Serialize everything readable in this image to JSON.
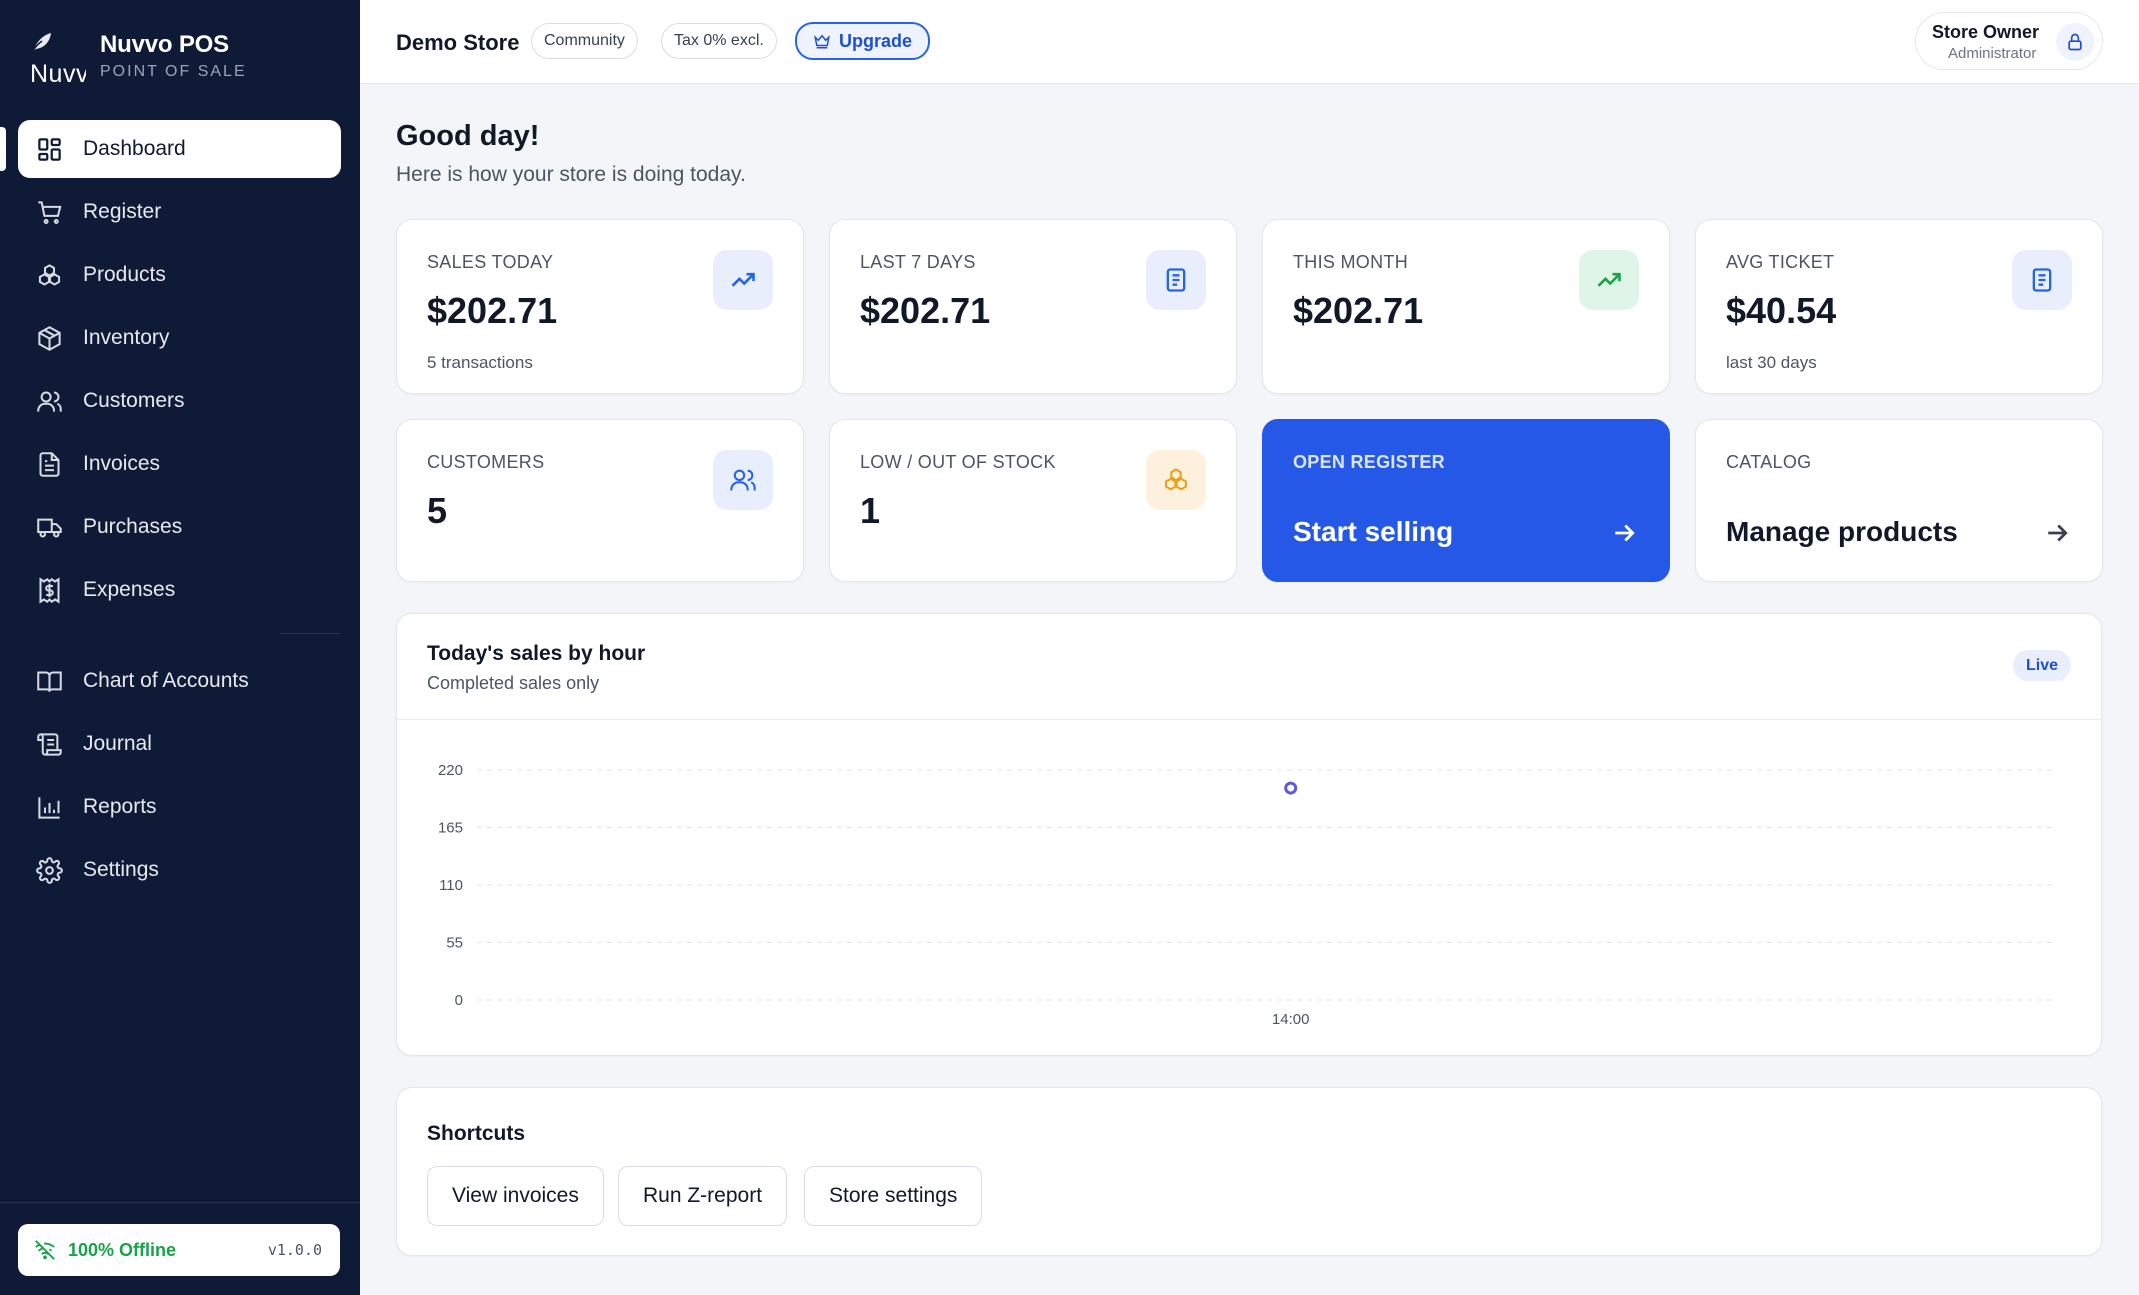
{
  "brand": {
    "logo_text": "Nuvvo",
    "name": "Nuvvo POS",
    "subtitle": "POINT OF SALE"
  },
  "sidebar": {
    "items": [
      {
        "label": "Dashboard",
        "icon": "dashboard-grid-icon",
        "active": true
      },
      {
        "label": "Register",
        "icon": "cart-icon"
      },
      {
        "label": "Products",
        "icon": "boxes-icon"
      },
      {
        "label": "Inventory",
        "icon": "package-icon"
      },
      {
        "label": "Customers",
        "icon": "users-icon"
      },
      {
        "label": "Invoices",
        "icon": "file-text-icon"
      },
      {
        "label": "Purchases",
        "icon": "truck-icon"
      },
      {
        "label": "Expenses",
        "icon": "receipt-dollar-icon"
      }
    ],
    "items2": [
      {
        "label": "Chart of Accounts",
        "icon": "book-icon"
      },
      {
        "label": "Journal",
        "icon": "scroll-icon"
      },
      {
        "label": "Reports",
        "icon": "bar-chart-icon"
      },
      {
        "label": "Settings",
        "icon": "gear-icon"
      }
    ],
    "offline_label": "100% Offline",
    "version": "v1.0.0"
  },
  "header": {
    "store_name": "Demo Store",
    "plan_badge": "Community",
    "tax_badge": "Tax 0% excl.",
    "upgrade_label": "Upgrade",
    "user_name": "Store Owner",
    "user_role": "Administrator"
  },
  "greeting": {
    "title": "Good day!",
    "subtitle": "Here is how your store is doing today."
  },
  "stats": [
    {
      "label": "SALES TODAY",
      "value": "$202.71",
      "sub": "5 transactions",
      "icon": "trending-up-icon",
      "tone": "blue"
    },
    {
      "label": "LAST 7 DAYS",
      "value": "$202.71",
      "sub": "",
      "icon": "receipt-icon",
      "tone": "blue"
    },
    {
      "label": "THIS MONTH",
      "value": "$202.71",
      "sub": "",
      "icon": "trending-up-icon",
      "tone": "green"
    },
    {
      "label": "AVG TICKET",
      "value": "$40.54",
      "sub": "last 30 days",
      "icon": "receipt-icon",
      "tone": "blue"
    },
    {
      "label": "CUSTOMERS",
      "value": "5",
      "sub": "",
      "icon": "users-icon",
      "tone": "blue"
    },
    {
      "label": "LOW / OUT OF STOCK",
      "value": "1",
      "sub": "",
      "icon": "boxes-icon",
      "tone": "amber"
    }
  ],
  "actions": {
    "register": {
      "label": "OPEN REGISTER",
      "title": "Start selling"
    },
    "catalog": {
      "label": "CATALOG",
      "title": "Manage products"
    }
  },
  "chart": {
    "title": "Today's sales by hour",
    "subtitle": "Completed sales only",
    "badge": "Live"
  },
  "chart_data": {
    "type": "line",
    "title": "Today's sales by hour",
    "subtitle": "Completed sales only",
    "x": [
      "14:00"
    ],
    "series": [
      {
        "values": [
          202.71
        ]
      }
    ],
    "y_ticks": [
      0,
      55,
      110,
      165,
      220
    ],
    "ylim": [
      0,
      220
    ],
    "grid": true,
    "point_color": "#5b5bd6"
  },
  "shortcuts": {
    "title": "Shortcuts",
    "buttons": [
      "View invoices",
      "Run Z-report",
      "Store settings"
    ]
  },
  "colors": {
    "sidebar_bg": "#0f1a36",
    "accent": "#2558e6",
    "online_green": "#16a34a"
  }
}
